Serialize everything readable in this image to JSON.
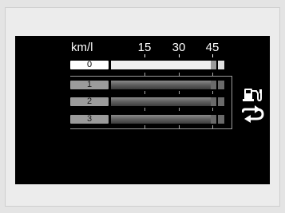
{
  "display": {
    "unit": "km/l",
    "scale_labels": [
      "15",
      "30",
      "45"
    ],
    "trips": [
      {
        "label": "0",
        "level": 0.88
      },
      {
        "label": "1",
        "level": 0.88
      },
      {
        "label": "2",
        "level": 0.88
      },
      {
        "label": "3",
        "level": 0.88
      }
    ]
  },
  "icons": {
    "fuel": "fuel-pump-icon",
    "cycle": "cycle-arrows-icon"
  },
  "colors": {
    "background": "#000000",
    "current_label": "#ffffff",
    "past_label": "#9b9b9b",
    "bar_current": "#f2f2f2",
    "bar_past": "#6a6a6a"
  }
}
